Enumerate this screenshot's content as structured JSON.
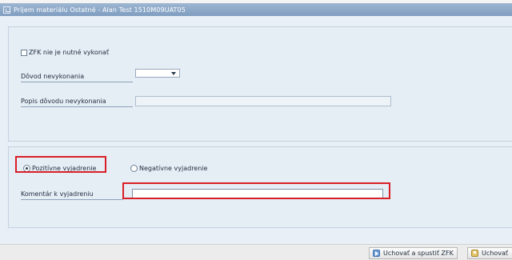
{
  "window": {
    "title": "Príjem materiálu Ostatné - Alan Test 1510M09UAT05"
  },
  "section1": {
    "zfk_checkbox_label": "ZFK nie je nutné vykonať",
    "zfk_checked": false,
    "reason_label": "Dôvod nevykonania",
    "reason_value": "",
    "description_label": "Popis dôvodu nevykonania",
    "description_value": ""
  },
  "section2": {
    "positive_label": "Pozitívne vyjadrenie",
    "negative_label": "Negatívne vyjadrenie",
    "selected": "positive",
    "comment_label": "Komentár k vyjadreniu",
    "comment_value": ""
  },
  "footer": {
    "save_run_label": "Uchovať a spustiť ZFK",
    "save_label": "Uchovať"
  },
  "colors": {
    "highlight": "#d91f26",
    "titlebar": "#8ba8c8",
    "panel": "#e5edf5"
  },
  "icons": {
    "window": "window-icon",
    "save_run": "save-and-run-icon",
    "save": "save-icon"
  }
}
